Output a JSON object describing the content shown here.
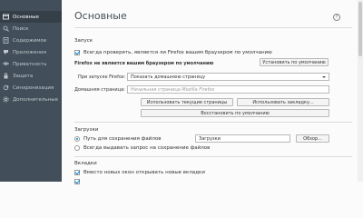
{
  "sidebar": {
    "items": [
      {
        "label": "Основные",
        "icon": "general-icon",
        "active": true
      },
      {
        "label": "Поиск",
        "icon": "search-icon",
        "active": false
      },
      {
        "label": "Содержимое",
        "icon": "content-icon",
        "active": false
      },
      {
        "label": "Приложения",
        "icon": "applications-icon",
        "active": false
      },
      {
        "label": "Приватность",
        "icon": "privacy-icon",
        "active": false
      },
      {
        "label": "Защита",
        "icon": "security-icon",
        "active": false
      },
      {
        "label": "Синхронизация",
        "icon": "sync-icon",
        "active": false
      },
      {
        "label": "Дополнительные",
        "icon": "advanced-icon",
        "active": false
      }
    ]
  },
  "page": {
    "title": "Основные",
    "help": "?"
  },
  "startup": {
    "title": "Запуск",
    "check_default": "Всегда проверять, является ли Firefox вашим браузером по умолчанию",
    "not_default_msg": "Firefox не является вашим браузером по умолчанию",
    "make_default_button": "Установить по умолчанию",
    "on_start_label": "При запуске Firefox:",
    "on_start_value": "Показать домашнюю страницу",
    "homepage_label": "Домашняя страница:",
    "homepage_placeholder": "Начальная страница Mozilla Firefox",
    "use_current_button": "Использовать текущие страницы",
    "use_bookmark_button": "Использовать закладку...",
    "restore_default_button": "Восстановить по умолчанию"
  },
  "downloads": {
    "title": "Загрузки",
    "save_to_label": "Путь для сохранения файлов",
    "save_to_value": "Загрузки",
    "browse_button": "Обзор...",
    "always_ask_label": "Всегда выдавать запрос на сохранение файлов"
  },
  "tabs": {
    "title": "Вкладки",
    "open_new_windows": "Вместо новых окон открывать новые вкладки"
  },
  "colors": {
    "sidebar_bg": "#424f5a",
    "sidebar_active": "#343f48",
    "accent": "#0a84d6"
  }
}
